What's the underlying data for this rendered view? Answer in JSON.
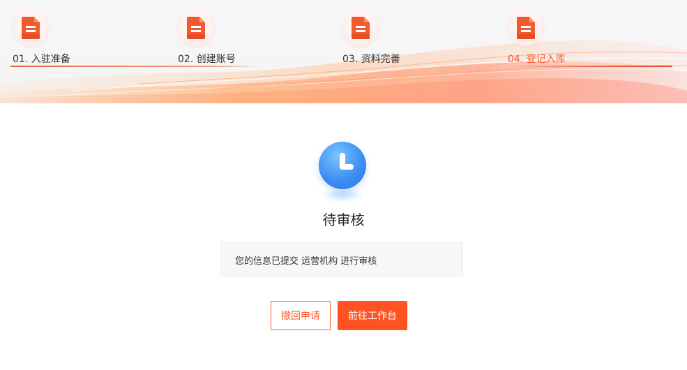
{
  "steps": [
    {
      "label": "01. 入驻准备",
      "active": false
    },
    {
      "label": "02. 创建账号",
      "active": false
    },
    {
      "label": "03. 资料完善",
      "active": false
    },
    {
      "label": "04. 登记入库",
      "active": true
    }
  ],
  "icons": {
    "step": "document-icon",
    "status": "clock-icon"
  },
  "status": {
    "title": "待审核",
    "message": "您的信息已提交 运营机构 进行审核"
  },
  "buttons": {
    "withdraw": "撤回申请",
    "go_workbench": "前往工作台"
  },
  "colors": {
    "accent": "#ff5422",
    "status_blue": "#3d8ff2"
  }
}
